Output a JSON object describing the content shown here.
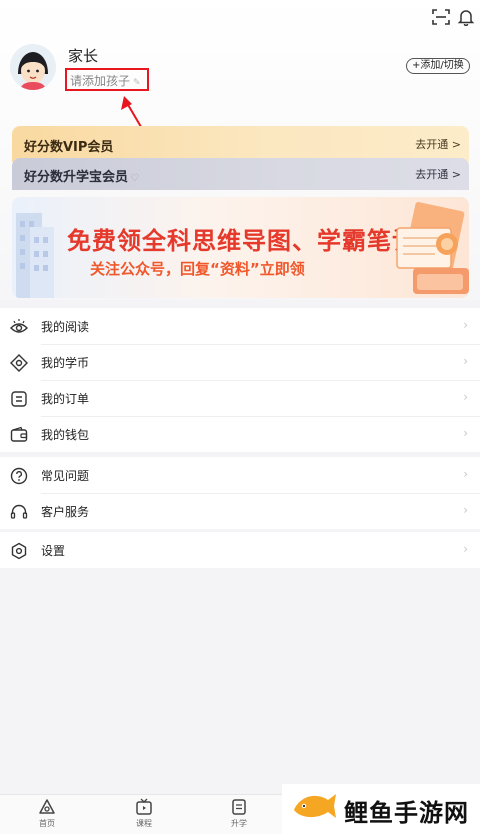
{
  "header": {
    "username": "家长",
    "add_child_label": "请添加孩子",
    "switch_button": "+添加/切换"
  },
  "vip_cards": [
    {
      "title": "好分数VIP会员",
      "action": "去开通 >"
    },
    {
      "title": "好分数升学宝会员",
      "action": "去开通 >"
    }
  ],
  "banner": {
    "title": "免费领全科思维导图、学霸笔记",
    "subtitle": "关注公众号，回复“资料”立即领"
  },
  "menu_group_1": [
    {
      "label": "我的阅读",
      "icon": "eye-icon"
    },
    {
      "label": "我的学币",
      "icon": "coin-icon"
    },
    {
      "label": "我的订单",
      "icon": "order-icon"
    },
    {
      "label": "我的钱包",
      "icon": "wallet-icon"
    }
  ],
  "menu_group_2": [
    {
      "label": "常见问题",
      "icon": "question-icon"
    },
    {
      "label": "客户服务",
      "icon": "headset-icon"
    }
  ],
  "menu_group_3": [
    {
      "label": "设置",
      "icon": "settings-icon"
    }
  ],
  "bottom_nav": [
    {
      "label": "首页",
      "icon": "home-icon"
    },
    {
      "label": "课程",
      "icon": "course-icon"
    },
    {
      "label": "升学",
      "icon": "enroll-icon"
    }
  ],
  "watermark": {
    "text": "鲤鱼手游网"
  },
  "colors": {
    "annotation_red": "#e8161e",
    "vip_gold": "#f9d9a0",
    "sx_grey": "#c9cbd8",
    "banner_red": "#e5392c"
  }
}
